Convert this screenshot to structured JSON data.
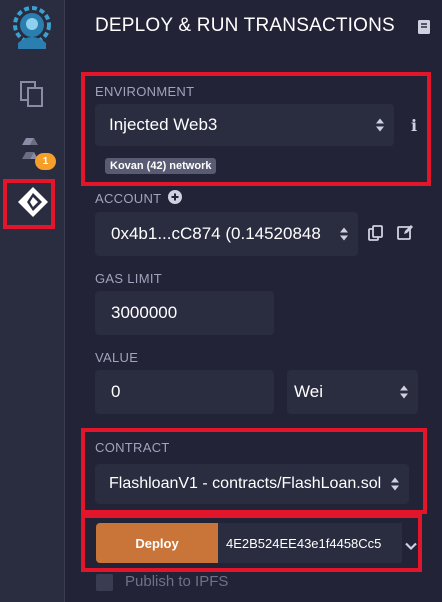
{
  "header": {
    "title": "DEPLOY & RUN TRANSACTIONS"
  },
  "sidebar": {
    "items": [
      {
        "icon": "remix-logo-icon"
      },
      {
        "icon": "file-explorer-icon"
      },
      {
        "icon": "solidity-compiler-icon",
        "badge": "1"
      },
      {
        "icon": "deploy-run-icon",
        "active": true
      }
    ]
  },
  "environment": {
    "label": "ENVIRONMENT",
    "value": "Injected Web3",
    "network_badge": "Kovan (42) network"
  },
  "account": {
    "label": "ACCOUNT",
    "value": "0x4b1...cC874 (0.14520848"
  },
  "gas_limit": {
    "label": "GAS LIMIT",
    "value": "3000000"
  },
  "value": {
    "label": "VALUE",
    "amount": "0",
    "unit": "Wei"
  },
  "contract": {
    "label": "CONTRACT",
    "value": "FlashloanV1 - contracts/FlashLoan.sol"
  },
  "deploy": {
    "button_label": "Deploy",
    "input_value": "4E2B524EE43e1f4458Cc5"
  },
  "publish": {
    "label": "Publish to IPFS"
  },
  "colors": {
    "background": "#222336",
    "panel": "#2a2c3f",
    "accent_orange": "#c97539",
    "highlight_red": "#e3152b",
    "badge_orange": "#f59e2a"
  }
}
